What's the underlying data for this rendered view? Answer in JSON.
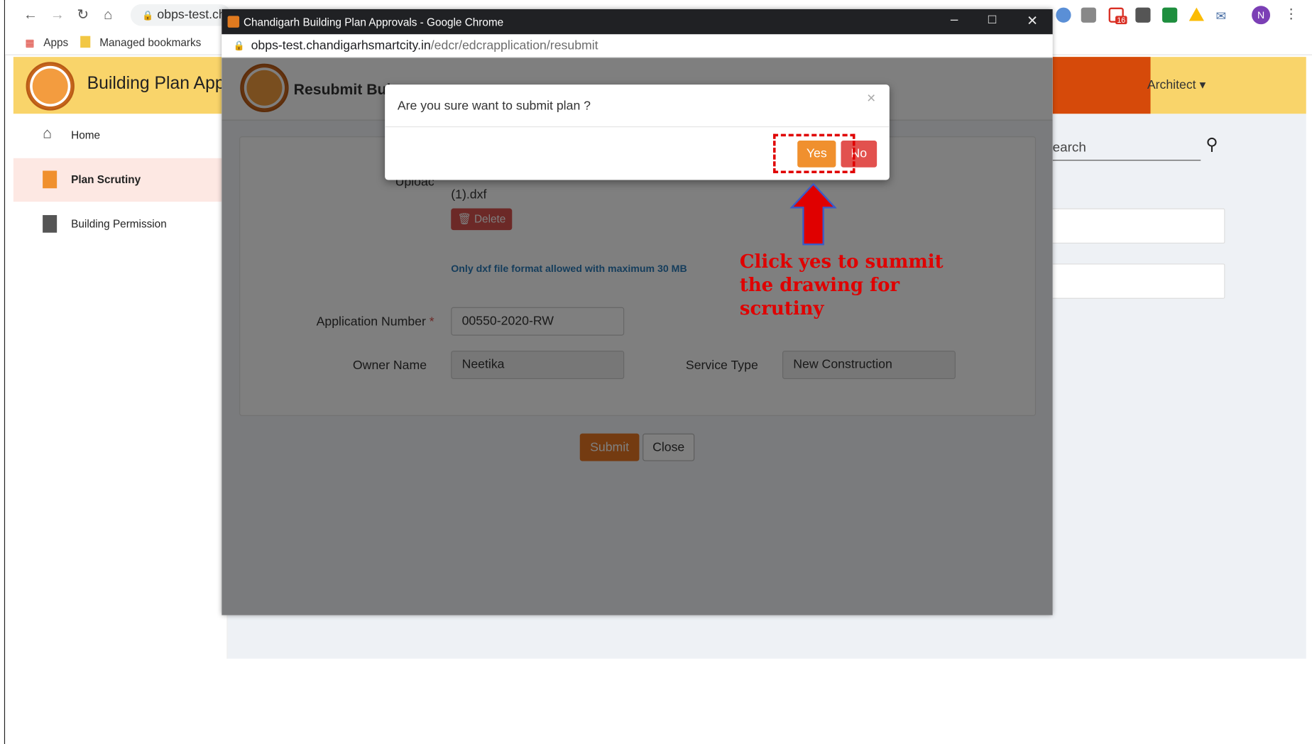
{
  "browser": {
    "omnibox_text": "obps-test.ch",
    "bookmarks": {
      "apps": "Apps",
      "managed": "Managed bookmarks"
    },
    "profile_initial": "N",
    "gmail_badge": "16"
  },
  "app": {
    "title": "Building Plan App",
    "user_menu": "Architect ▾",
    "search_placeholder": "earch",
    "sidebar": [
      {
        "label": "Home",
        "icon": "home-icon"
      },
      {
        "label": "Plan Scrutiny",
        "icon": "building-icon",
        "active": true
      },
      {
        "label": "Building Permission",
        "icon": "building-icon"
      }
    ]
  },
  "popup": {
    "window_title": "Chandigarh Building Plan Approvals - Google Chrome",
    "url_host": "obps-test.chandigarhsmartcity.in",
    "url_path": "/edcr/edcrapplication/resubmit",
    "page_heading": "Resubmit Bui",
    "upload_label": "Uploac",
    "file_name": "(1).dxf",
    "delete_button": "Delete",
    "file_note": "Only dxf file format allowed with maximum 30 MB",
    "application_number_label": "Application Number",
    "required_mark": "*",
    "application_number_value": "00550-2020-RW",
    "owner_name_label": "Owner Name",
    "owner_name_value": "Neetika",
    "service_type_label": "Service Type",
    "service_type_value": "New Construction",
    "submit_button": "Submit",
    "close_button": "Close"
  },
  "confirm_dialog": {
    "question": "Are you sure want to submit plan ?",
    "close_symbol": "×",
    "yes_button": "Yes",
    "no_button": "No"
  },
  "annotation": {
    "text": "Click yes to summit the drawing for scrutiny",
    "color": "#e00000"
  },
  "colors": {
    "header_yellow": "#f9d46a",
    "header_orange": "#d64a0a",
    "primary_button": "#f0902e",
    "no_button": "#e2514e",
    "submit_button": "#e87722"
  }
}
